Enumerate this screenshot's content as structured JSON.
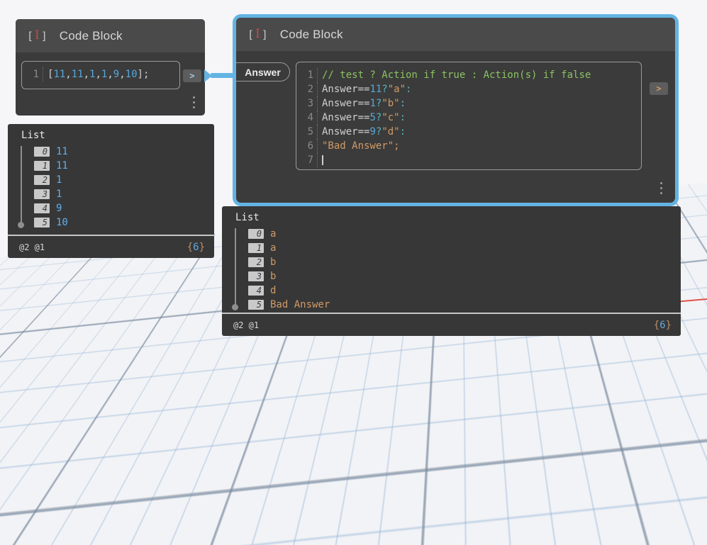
{
  "colors": {
    "accent": "#63b4e3",
    "node_body": "#3b3b3b",
    "node_header": "#4a4a4a",
    "panel_body": "#373737",
    "border_gray": "#9a9a9a",
    "title_text": "#d6d6d6",
    "icon_red": "#c04a4a",
    "line_number": "#8a8a8a",
    "code_default": "#cfcfcf",
    "code_number": "#56a8dc",
    "code_string": "#d19a66",
    "code_comment": "#8bc262",
    "code_operator": "#56b6c2",
    "value_number": "#61afef",
    "value_string": "#d19a66",
    "badge_bg": "#c9c9c9",
    "badge_text": "#3b3b3b",
    "out_arrow_1": "#9fc9e4",
    "out_arrow_2": "#cfa05e",
    "axis_red": "#e0514b",
    "axis_green": "#3fae44",
    "count_brace": "#b5906b",
    "count_digit": "#5fa8e0",
    "footer_text": "#d8d8d8"
  },
  "node_icon": {
    "left": "[",
    "cursor": "I",
    "right": "]"
  },
  "node1": {
    "title": "Code Block",
    "output_label": ">",
    "code": {
      "lines": [
        {
          "no": "1",
          "segs": [
            [
              "pun",
              "["
            ],
            [
              "num",
              "11"
            ],
            [
              "pun",
              ","
            ],
            [
              "num",
              "11"
            ],
            [
              "pun",
              ","
            ],
            [
              "num",
              "1"
            ],
            [
              "pun",
              ","
            ],
            [
              "num",
              "1"
            ],
            [
              "pun",
              ","
            ],
            [
              "num",
              "9"
            ],
            [
              "pun",
              ","
            ],
            [
              "num",
              "10"
            ],
            [
              "pun",
              "];"
            ]
          ]
        }
      ]
    }
  },
  "node2": {
    "title": "Code Block",
    "input_label": "Answer",
    "output_label": ">",
    "code": {
      "lines": [
        {
          "no": "1",
          "segs": [
            [
              "com",
              "// test ? Action if true : Action(s) if false"
            ]
          ]
        },
        {
          "no": "2",
          "segs": [
            [
              "def",
              "Answer=="
            ],
            [
              "num",
              "11"
            ],
            [
              "op",
              "?"
            ],
            [
              "str",
              "\"a\""
            ],
            [
              "op",
              ":"
            ]
          ]
        },
        {
          "no": "3",
          "segs": [
            [
              "def",
              "Answer=="
            ],
            [
              "num",
              "1"
            ],
            [
              "op",
              "?"
            ],
            [
              "str",
              "\"b\""
            ],
            [
              "op",
              ":"
            ]
          ]
        },
        {
          "no": "4",
          "segs": [
            [
              "def",
              "Answer=="
            ],
            [
              "num",
              "5"
            ],
            [
              "op",
              "?"
            ],
            [
              "str",
              "\"c\""
            ],
            [
              "op",
              ":"
            ]
          ]
        },
        {
          "no": "5",
          "segs": [
            [
              "def",
              "Answer=="
            ],
            [
              "num",
              "9"
            ],
            [
              "op",
              "?"
            ],
            [
              "str",
              "\"d\""
            ],
            [
              "op",
              ":"
            ]
          ]
        },
        {
          "no": "6",
          "segs": [
            [
              "str",
              "\"Bad Answer\";"
            ]
          ]
        },
        {
          "no": "7",
          "segs": [
            [
              "cursor",
              ""
            ]
          ]
        }
      ]
    }
  },
  "panel1": {
    "title": "List",
    "rows": [
      {
        "index": "0",
        "value": "11"
      },
      {
        "index": "1",
        "value": "11"
      },
      {
        "index": "2",
        "value": "1"
      },
      {
        "index": "3",
        "value": "1"
      },
      {
        "index": "4",
        "value": "9"
      },
      {
        "index": "5",
        "value": "10"
      }
    ],
    "footer_left": "@2 @1",
    "count_open": "{",
    "count": "6",
    "count_close": "}"
  },
  "panel2": {
    "title": "List",
    "rows": [
      {
        "index": "0",
        "value": "a"
      },
      {
        "index": "1",
        "value": "a"
      },
      {
        "index": "2",
        "value": "b"
      },
      {
        "index": "3",
        "value": "b"
      },
      {
        "index": "4",
        "value": "d"
      },
      {
        "index": "5",
        "value": "Bad Answer"
      }
    ],
    "footer_left": "@2 @1",
    "count_open": "{",
    "count": "6",
    "count_close": "}"
  }
}
